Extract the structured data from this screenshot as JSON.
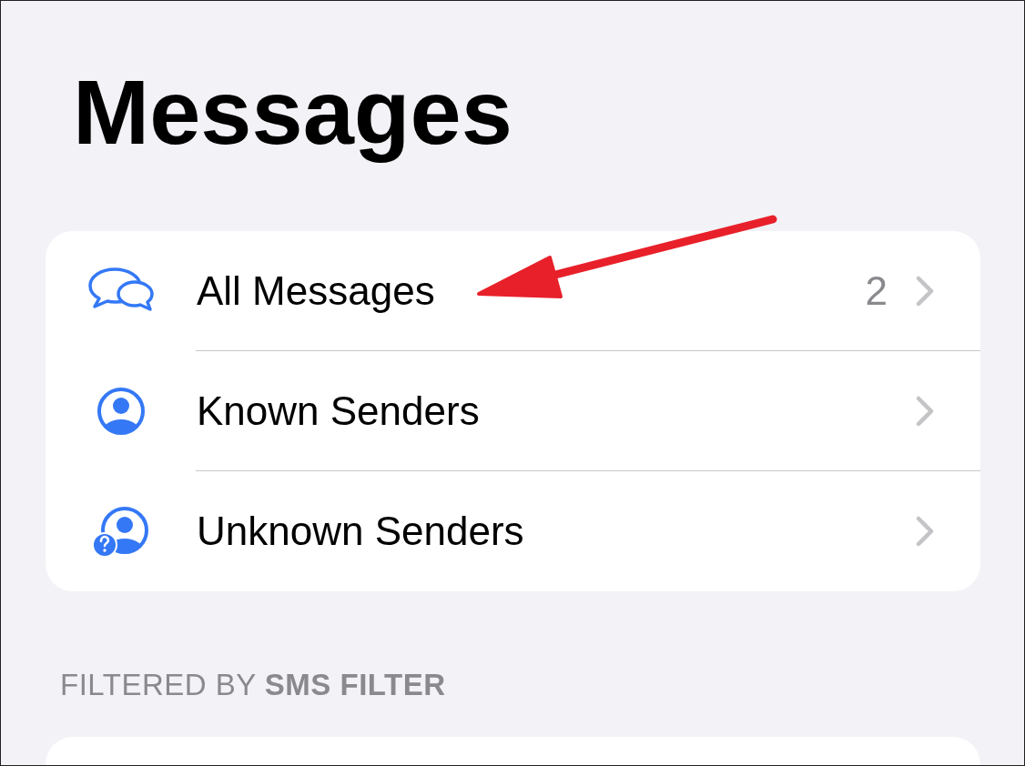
{
  "title": "Messages",
  "items": [
    {
      "kind": "bubbles",
      "label": "All Messages",
      "count": "2"
    },
    {
      "kind": "person",
      "label": "Known Senders"
    },
    {
      "kind": "unknown",
      "label": "Unknown Senders"
    }
  ],
  "section_header": "FILTERED BY **SMS FILTER**"
}
